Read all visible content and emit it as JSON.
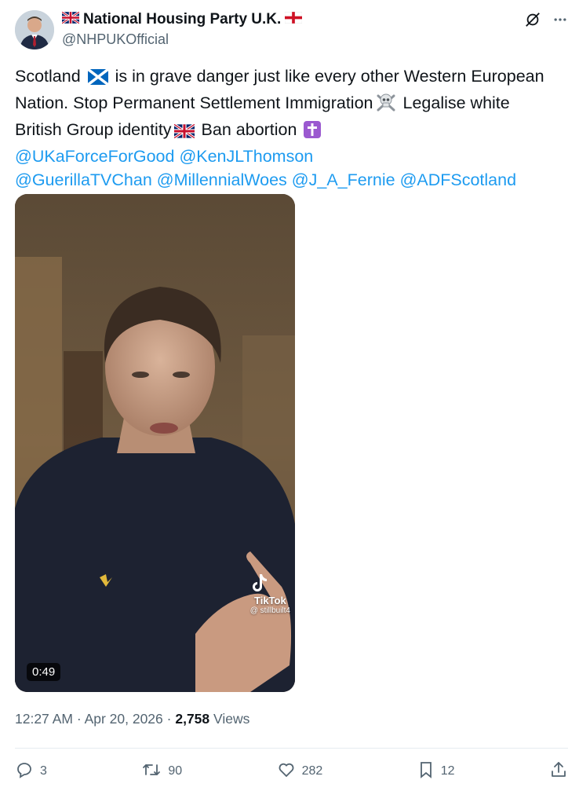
{
  "author": {
    "name": "National Housing Party U.K.",
    "handle": "@NHPUKOfficial"
  },
  "tweet": {
    "lines": {
      "l1_a": "Scotland",
      "l1_b": "is in grave danger just like every other Western European",
      "l2_a": "Nation. Stop Permanent Settlement Immigration",
      "l2_b": "Legalise white",
      "l3_a": "British Group identity",
      "l3_b": "Ban abortion"
    },
    "mentions": [
      "@UKaForceForGood",
      "@KenJLThomson",
      "@GuerillaTVChan",
      "@MillennialWoes",
      "@J_A_Fernie",
      "@ADFScotland"
    ]
  },
  "media": {
    "duration": "0:49",
    "watermark": "TikTok",
    "watermark_user": "@ stillbuilt4"
  },
  "meta": {
    "time": "12:27 AM",
    "date": "Apr 20, 2026",
    "views_count": "2,758",
    "views_label": "Views"
  },
  "actions": {
    "replies": "3",
    "reposts": "90",
    "likes": "282",
    "bookmarks": "12"
  },
  "icons": [
    "grok-icon",
    "more-icon",
    "reply-icon",
    "repost-icon",
    "like-icon",
    "bookmark-icon",
    "share-icon",
    "uk-flag-icon",
    "england-flag-icon",
    "scotland-flag-icon",
    "skull-crossbones-icon",
    "latin-cross-icon"
  ],
  "colors": {
    "link": "#1d9bf0",
    "secondary_text": "#536471",
    "text": "#0f1419"
  }
}
